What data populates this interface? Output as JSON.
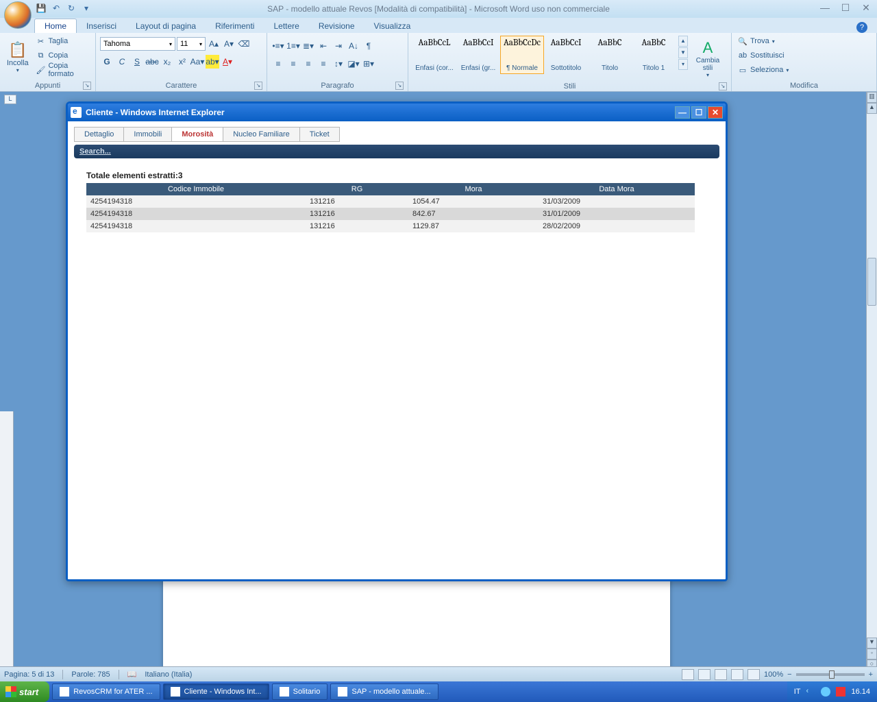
{
  "word": {
    "title": "SAP - modello attuale Revos [Modalità di compatibilità] - Microsoft Word uso non commerciale",
    "tabs": [
      "Home",
      "Inserisci",
      "Layout di pagina",
      "Riferimenti",
      "Lettere",
      "Revisione",
      "Visualizza"
    ],
    "clipboard": {
      "group": "Appunti",
      "paste": "Incolla",
      "cut": "Taglia",
      "copy": "Copia",
      "format": "Copia formato"
    },
    "font": {
      "group": "Carattere",
      "name": "Tahoma",
      "size": "11"
    },
    "para": {
      "group": "Paragrafo"
    },
    "styles": {
      "group": "Stili",
      "change": "Cambia stili",
      "items": [
        {
          "preview": "AaBbCcL",
          "label": "Enfasi (cor..."
        },
        {
          "preview": "AaBbCcI",
          "label": "Enfasi (gr..."
        },
        {
          "preview": "AaBbCcDc",
          "label": "¶ Normale",
          "selected": true
        },
        {
          "preview": "AaBbCcI",
          "label": "Sottotitolo"
        },
        {
          "preview": "AaBbC",
          "label": "Titolo"
        },
        {
          "preview": "AaBbC",
          "label": "Titolo 1"
        }
      ]
    },
    "edit": {
      "group": "Modifica",
      "find": "Trova",
      "replace": "Sostituisci",
      "select": "Seleziona"
    },
    "status": {
      "page": "Pagina: 5 di 13",
      "words": "Parole: 785",
      "lang": "Italiano (Italia)",
      "zoom": "100%"
    },
    "indicator": "L"
  },
  "ie": {
    "title": "Cliente - Windows Internet Explorer",
    "tabs": [
      "Dettaglio",
      "Immobili",
      "Morosità",
      "Nucleo Familiare",
      "Ticket"
    ],
    "active_tab": "Morosità",
    "search": "Search...",
    "totale_label": "Totale elementi estratti:",
    "totale_count": "3",
    "columns": [
      "Codice Immobile",
      "RG",
      "Mora",
      "Data Mora"
    ],
    "rows": [
      {
        "codice": "4254194318",
        "rg": "131216",
        "mora": "1054.47",
        "data": "31/03/2009"
      },
      {
        "codice": "4254194318",
        "rg": "131216",
        "mora": "842.67",
        "data": "31/01/2009"
      },
      {
        "codice": "4254194318",
        "rg": "131216",
        "mora": "1129.87",
        "data": "28/02/2009"
      }
    ]
  },
  "taskbar": {
    "start": "start",
    "items": [
      {
        "label": "RevosCRM for ATER ..."
      },
      {
        "label": "Cliente - Windows Int...",
        "active": true
      },
      {
        "label": "Solitario"
      },
      {
        "label": "SAP - modello attuale..."
      }
    ],
    "lang": "IT",
    "clock": "16.14"
  }
}
